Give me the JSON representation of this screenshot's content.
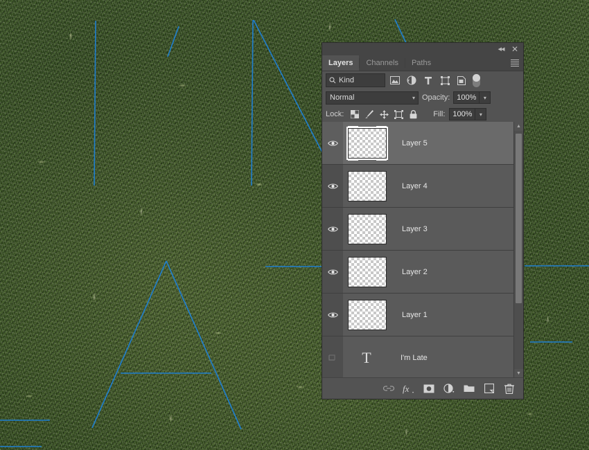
{
  "canvas": {
    "description": "grass-texture-photo",
    "guide_color": "#1f7fd0"
  },
  "panel": {
    "titlebar": {
      "collapse_label": "◂◂",
      "close_label": "✕"
    },
    "tabs": [
      {
        "label": "Layers",
        "active": true
      },
      {
        "label": "Channels",
        "active": false
      },
      {
        "label": "Paths",
        "active": false
      }
    ],
    "menu_icon": "panel-menu-icon",
    "filter": {
      "kind_label": "Kind",
      "search_icon": "search-icon",
      "icons": [
        "pixel-layer-filter-icon",
        "adjustment-layer-filter-icon",
        "type-layer-filter-icon",
        "shape-layer-filter-icon",
        "smart-object-filter-icon"
      ],
      "toggle": "filter-toggle-switch"
    },
    "blend": {
      "mode": "Normal",
      "opacity_label": "Opacity:",
      "opacity_value": "100%"
    },
    "lock": {
      "label": "Lock:",
      "icons": [
        "lock-transparent-pixels-icon",
        "lock-image-pixels-icon",
        "lock-position-icon",
        "lock-artboard-icon",
        "lock-all-icon"
      ],
      "fill_label": "Fill:",
      "fill_value": "100%"
    },
    "layers": [
      {
        "name": "Layer 5",
        "visible": true,
        "selected": true,
        "type": "pixel"
      },
      {
        "name": "Layer 4",
        "visible": true,
        "selected": false,
        "type": "pixel"
      },
      {
        "name": "Layer 3",
        "visible": true,
        "selected": false,
        "type": "pixel"
      },
      {
        "name": "Layer 2",
        "visible": true,
        "selected": false,
        "type": "pixel"
      },
      {
        "name": "Layer 1",
        "visible": true,
        "selected": false,
        "type": "pixel"
      },
      {
        "name": "I'm Late",
        "visible": false,
        "selected": false,
        "type": "text"
      }
    ],
    "scrollbar": {
      "up_arrow": "▲",
      "down_arrow": "▼"
    },
    "bottom_bar_icons": [
      "link-layers-icon",
      "layer-style-fx-icon",
      "add-layer-mask-icon",
      "adjustment-layer-icon",
      "new-group-icon",
      "new-layer-icon",
      "delete-layer-icon"
    ]
  }
}
